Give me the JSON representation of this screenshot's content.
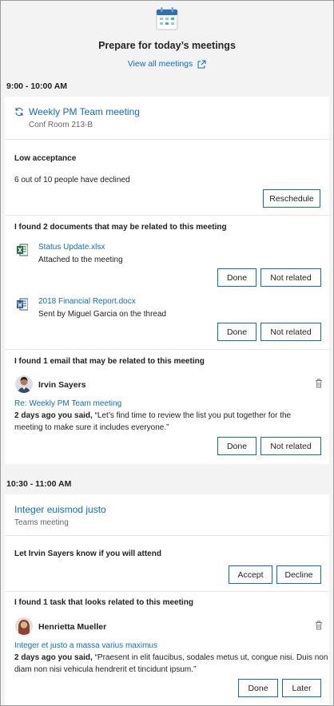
{
  "header": {
    "title": "Prepare for today’s meetings",
    "view_all": "View all meetings"
  },
  "meetings": [
    {
      "time": "9:00 - 10:00 AM",
      "title": "Weekly PM Team meeting",
      "location": "Conf Room 213-B",
      "acceptance": {
        "heading": "Low acceptance",
        "detail": "6 out of 10 people have declined",
        "button": "Reschedule"
      },
      "documents": {
        "heading": "I found 2 documents that may be related to this meeting",
        "items": [
          {
            "name": "Status Update.xlsx",
            "note": "Attached to the meeting",
            "type": "excel-icon"
          },
          {
            "name": "2018 Financial Report.docx",
            "note": "Sent by Miguel Garcia on the thread",
            "type": "word-icon"
          }
        ]
      },
      "email": {
        "heading": "I found 1 email that may be related to this meeting",
        "sender": "Irvin Sayers",
        "subject": "Re: Weekly PM Team meeting",
        "prefix": "2 days ago you said,",
        "quote": " “Let’s find time to review the list you put together for the",
        "quote2": "meeting to make sure it includes everyone.”"
      }
    },
    {
      "time": "10:30 - 11:00 AM",
      "title": "Integer euismod justo",
      "location": "Teams meeting",
      "rsvp": {
        "heading": "Let Irvin Sayers know if you will attend",
        "accept": "Accept",
        "decline": "Decline"
      },
      "task": {
        "heading": "I found 1 task that looks related to this meeting",
        "person": "Henrietta Mueller",
        "title": "Integer et justo a massa varius maximus",
        "prefix": "2 days ago you said,",
        "quote": " “Praesent in elit faucibus, sodales metus ut, congue nisi. Duis non",
        "quote2": "diam non nisi vehicula hendrerit et tincidunt ipsum.”",
        "done": "Done",
        "later": "Later"
      }
    }
  ],
  "buttons": {
    "done": "Done",
    "not_related": "Not related"
  },
  "colors": {
    "accent": "#0f6cbd",
    "excel": "#1d6f42",
    "word": "#2b579a"
  }
}
